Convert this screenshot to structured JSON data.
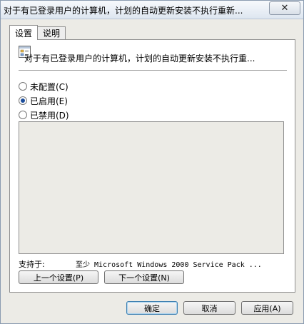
{
  "window": {
    "title": "对于有已登录用户的计算机，计划的自动更新安装不执行重新..."
  },
  "tabs": [
    {
      "label": "设置"
    },
    {
      "label": "说明"
    }
  ],
  "policy": {
    "title": "对于有已登录用户的计算机，计划的自动更新安装不执行重..."
  },
  "options": [
    {
      "label": "未配置(C)",
      "checked": false
    },
    {
      "label": "已启用(E)",
      "checked": true
    },
    {
      "label": "已禁用(D)",
      "checked": false
    }
  ],
  "support": {
    "label": "支持于:",
    "value": "至少 Microsoft Windows 2000 Service Pack ..."
  },
  "nav": {
    "prev_label": "上一个设置(P)",
    "next_label": "下一个设置(N)"
  },
  "footer": {
    "ok_label": "确定",
    "cancel_label": "取消",
    "apply_label": "应用(A)"
  },
  "icons": {
    "close": "close-icon",
    "policy": "policy-setting-icon"
  }
}
